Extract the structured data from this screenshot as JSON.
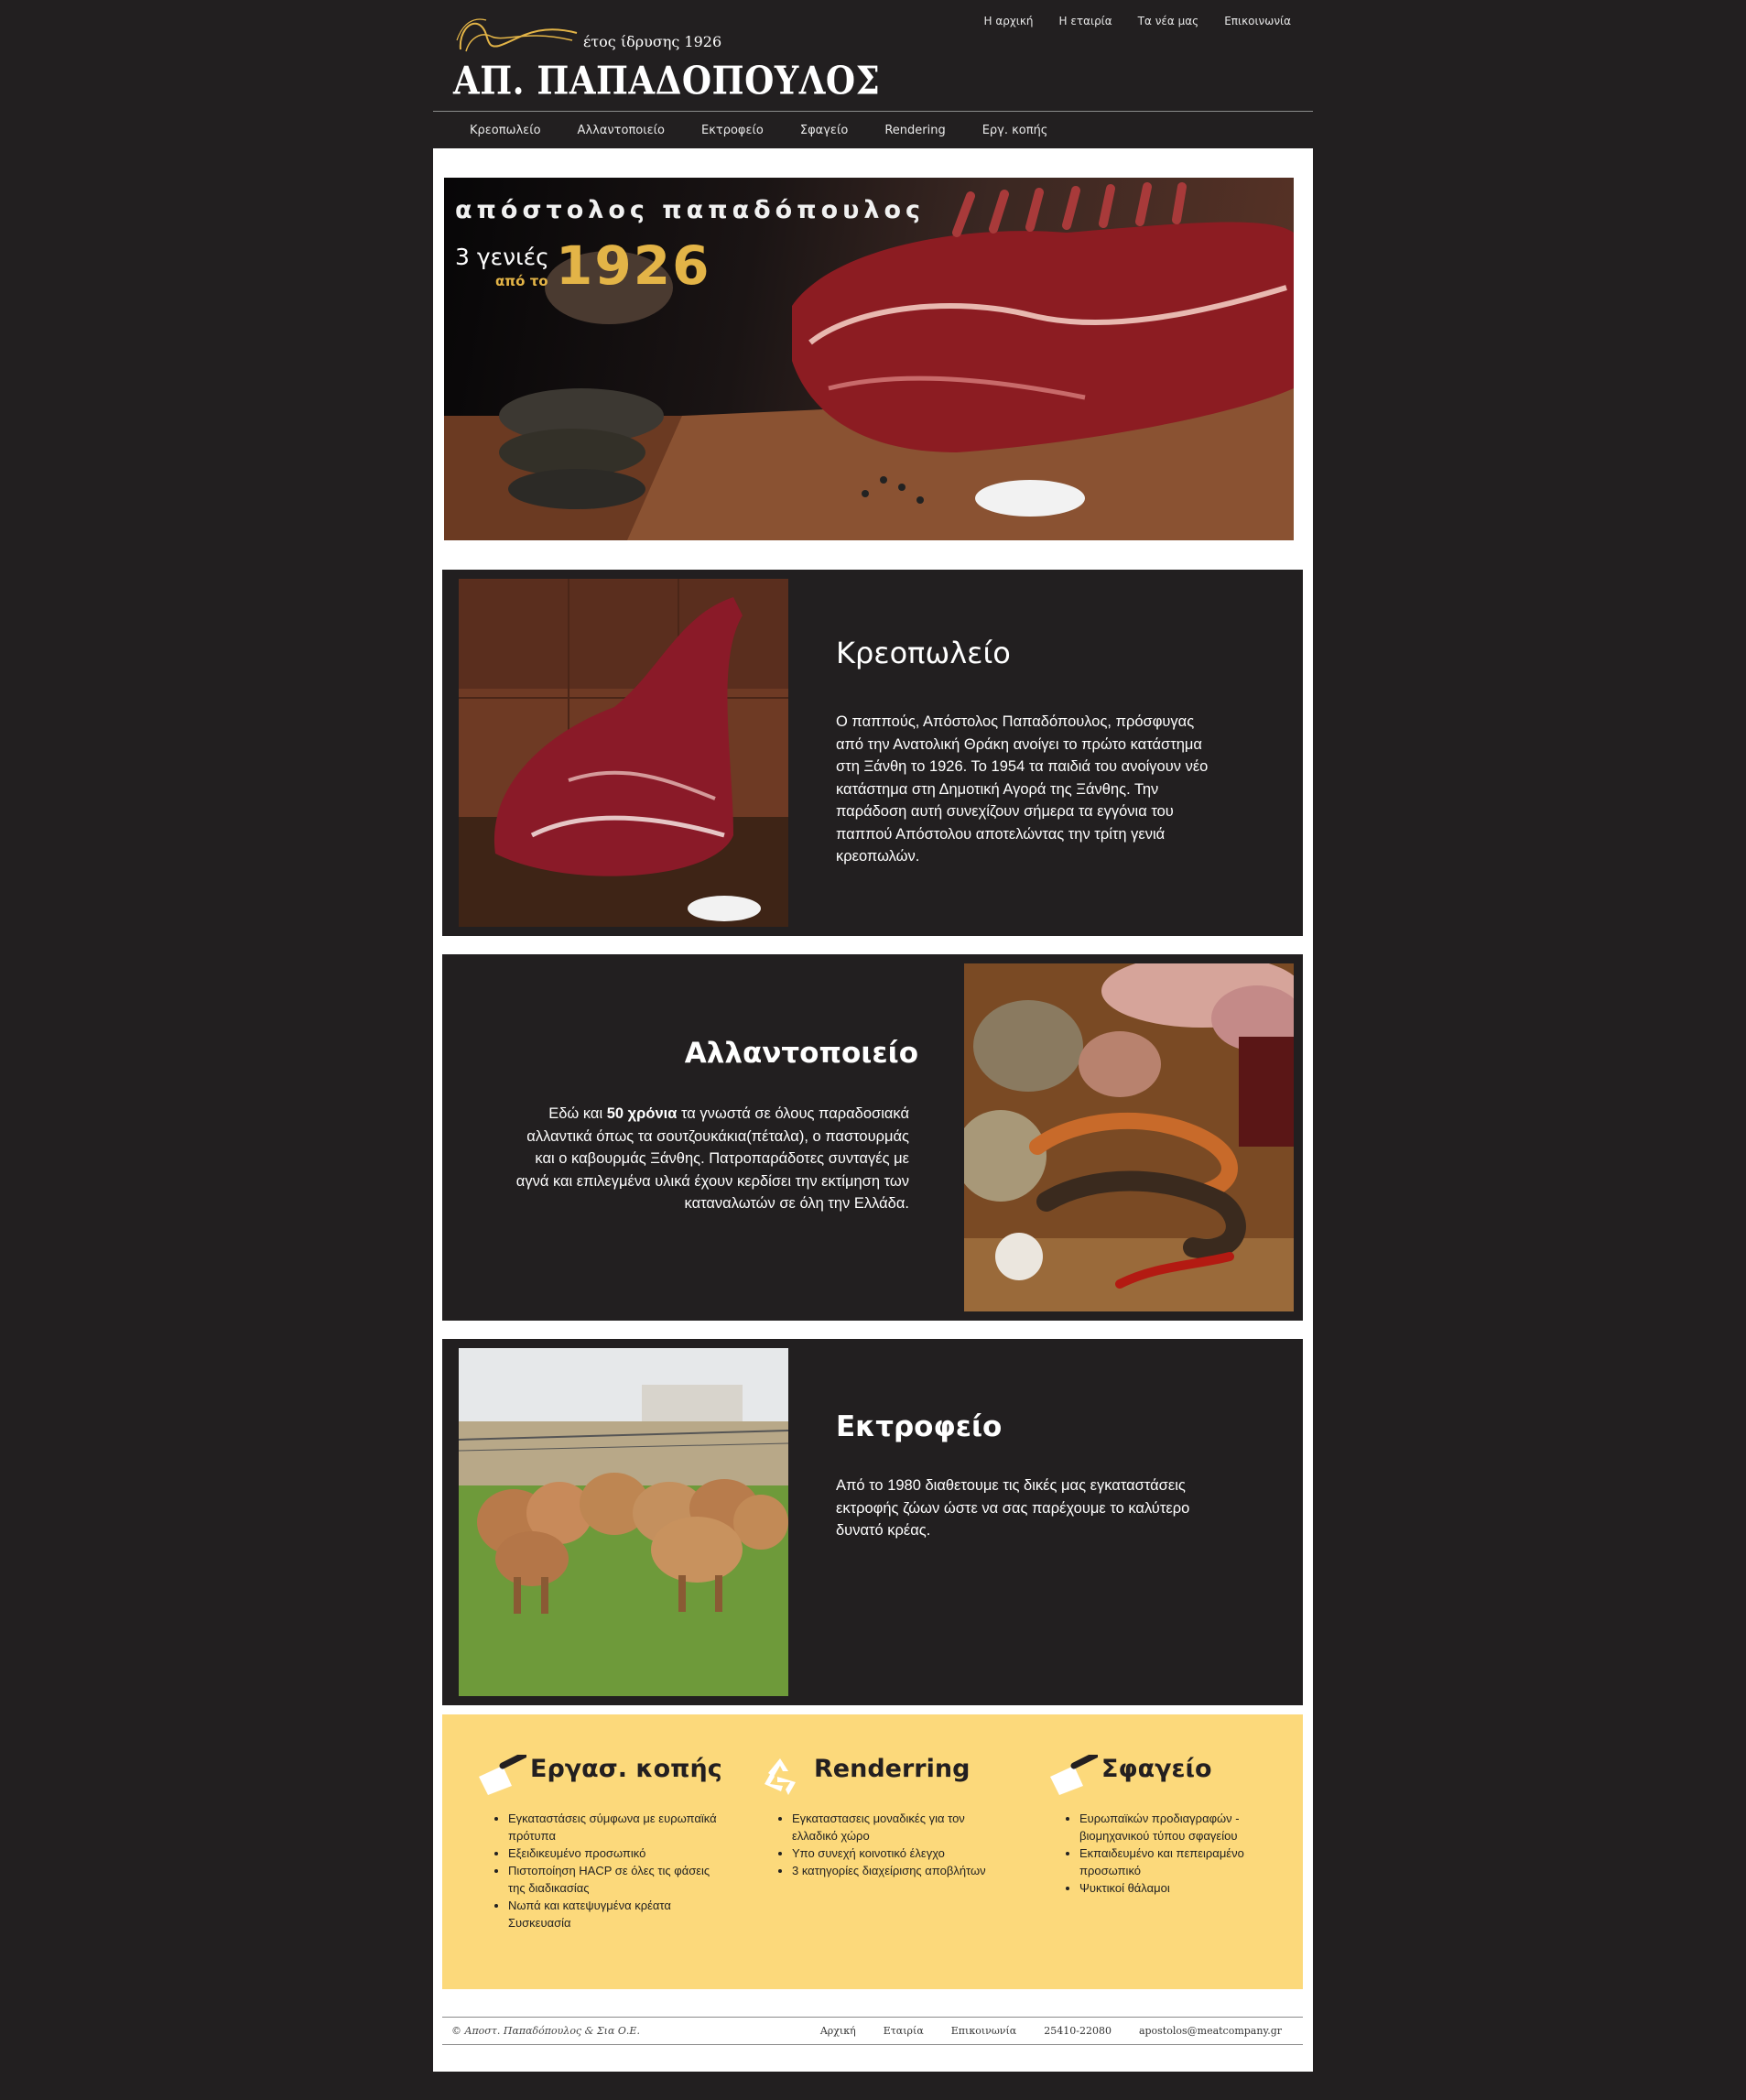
{
  "header": {
    "logo_tagline": "έτος ίδρυσης 1926",
    "logo_name": "ΑΠ. ΠΑΠΑΔΟΠΟΥΛΟΣ",
    "top_nav": [
      "Η αρχική",
      "Η εταιρία",
      "Τα νέα μας",
      "Επικοινωνία"
    ],
    "main_nav": [
      "Κρεοπωλείο",
      "Αλλαντοποιείο",
      "Εκτροφείο",
      "Σφαγείο",
      "Rendering",
      "Εργ. κοπής"
    ]
  },
  "hero": {
    "title": "απόστολος παπαδόπουλος",
    "sub1": "3 γενιές",
    "sub2": "από το",
    "year": "1926"
  },
  "sections": {
    "butcher": {
      "title": "Κρεοπωλείο",
      "text": "Ο παππούς, Απόστολος Παπαδόπουλος, πρόσφυγας από την Ανατολική Θράκη ανοίγει το πρώτο κατάστημα στη Ξάνθη το 1926. Το 1954 τα παιδιά του ανοίγουν νέο κατάστημα στη Δημοτική Αγορά της Ξάνθης. Την παράδοση αυτή συνεχίζουν σήμερα τα εγγόνια του παππού Απόστολου αποτελώντας την τρίτη γενιά κρεοπωλών."
    },
    "charcuterie": {
      "title": "Αλλαντοποιείο",
      "text_pre": "Εδώ και ",
      "text_bold": "50 χρόνια",
      "text_post": " τα γνωστά σε όλους παραδοσιακά αλλαντικά όπως τα σουτζουκάκια(πέταλα), ο παστουρμάς και ο καβουρμάς Ξάνθης. Πατροπαράδοτες συνταγές με αγνά και επιλεγμένα υλικά έχουν κερδίσει την εκτίμηση των καταναλωτών σε όλη την Ελλάδα."
    },
    "farm": {
      "title": "Εκτροφείο",
      "text": "Από το 1980 διαθετουμε τις δικές μας εγκαταστάσεις εκτροφής ζώων ώστε να σας παρέχουμε το καλύτερο δυνατό κρέας."
    }
  },
  "features": [
    {
      "title": "Εργασ. κοπής",
      "icon": "cleaver-icon",
      "items": [
        "Εγκαταστάσεις σύμφωνα με ευρωπαϊκά πρότυπα",
        "Εξειδικευμένο προσωπικό",
        "Πιστοποίηση HACP σε όλες τις φάσεις της διαδικασίας",
        "Νωπά και κατεψυγμένα κρέατα Συσκευασία"
      ]
    },
    {
      "title": "Renderring",
      "icon": "recycle-icon",
      "items": [
        "Εγκαταστασεις μοναδικές για τον ελλαδικό χώρο",
        "Υπο συνεχή κοινοτικό έλεγχο",
        "3 κατηγορίες διαχείρισης αποβλήτων"
      ]
    },
    {
      "title": "Σφαγείο",
      "icon": "cleaver-icon",
      "items": [
        "Ευρωπαϊκών προδιαγραφών - βιομηχανικού τύπου σφαγείου",
        "Εκπαιδευμένο και πεπειραμένο προσωπικό",
        "Ψυκτικοί θάλαμοι"
      ]
    }
  ],
  "footer": {
    "copyright": "© Αποστ. Παπαδόπουλος & Σια Ο.Ε.",
    "links": [
      "Αρχική",
      "Εταιρία",
      "Επικοινωνία"
    ],
    "phone": "25410-22080",
    "email": "apostolos@meatcompany.gr"
  },
  "colors": {
    "background": "#221f20",
    "accent_gold": "#e3b447",
    "feature_box": "#fcd97b"
  }
}
